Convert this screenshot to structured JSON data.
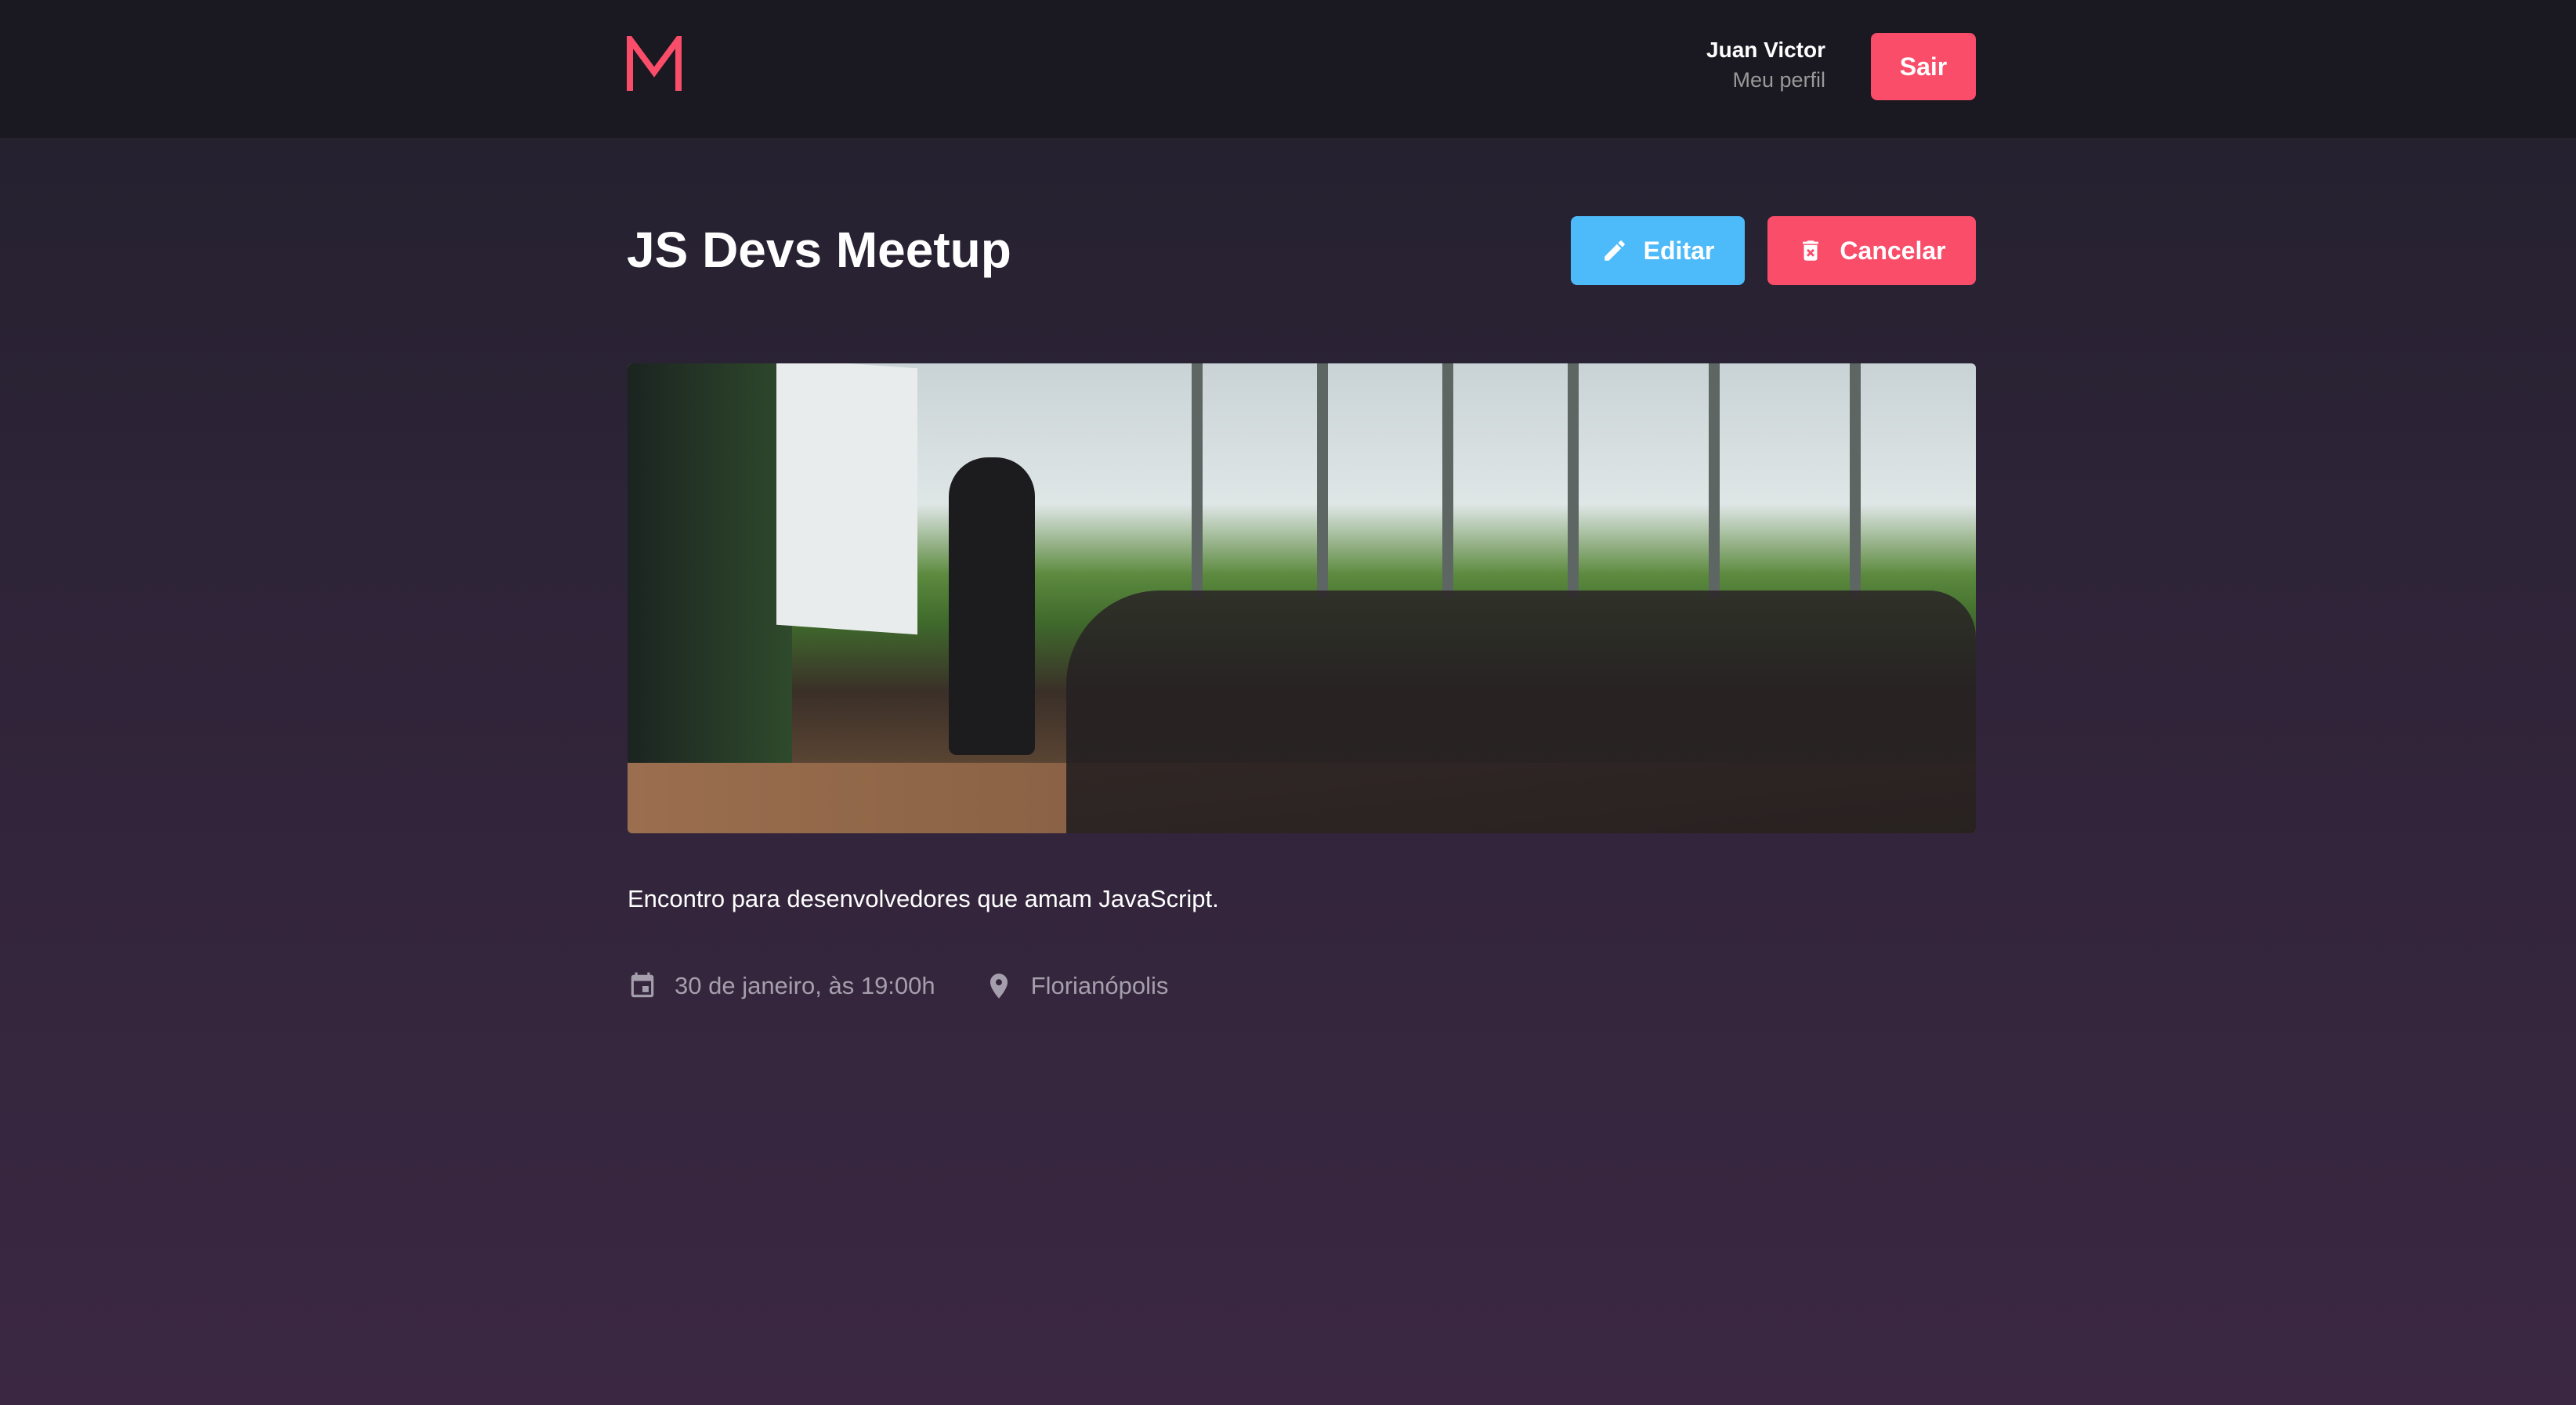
{
  "header": {
    "logo_text": "M",
    "user_name": "Juan Victor",
    "profile_link": "Meu perfil",
    "logout_label": "Sair"
  },
  "meetup": {
    "title": "JS Devs Meetup",
    "edit_label": "Editar",
    "cancel_label": "Cancelar",
    "description": "Encontro para desenvolvedores que amam JavaScript.",
    "date": "30 de janeiro, às 19:00h",
    "location": "Florianópolis"
  },
  "colors": {
    "primary": "#f94d6a",
    "edit": "#4dbaf9"
  }
}
